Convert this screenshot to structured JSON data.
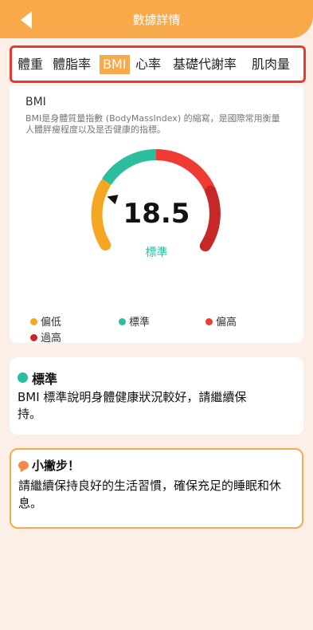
{
  "header": {
    "title": "數據詳情"
  },
  "tabs": [
    {
      "label": "體重",
      "active": false
    },
    {
      "label": "體脂率",
      "active": false
    },
    {
      "label": "BMI",
      "active": true
    },
    {
      "label": "心率",
      "active": false
    },
    {
      "label": "基礎代謝率",
      "active": false
    },
    {
      "label": "肌肉量",
      "active": false
    }
  ],
  "bmi_card": {
    "title": "BMI",
    "description": "BMI是身體質量指數 (BodyMassIndex) 的縮寫，是國際常用衡量人體胖瘦程度以及是否健康的指標。",
    "value": "18.5",
    "status": "標準",
    "legend": [
      {
        "label": "偏低",
        "color": "#f5a623"
      },
      {
        "label": "標準",
        "color": "#2bbd9e"
      },
      {
        "label": "偏高",
        "color": "#ef3b33"
      },
      {
        "label": "過高",
        "color": "#c62828"
      }
    ]
  },
  "status_card": {
    "heading": "標準",
    "text": "BMI 標準說明身體健康狀況較好，請繼續保持。"
  },
  "tip_card": {
    "heading": "小撇步！",
    "text": "請繼續保持良好的生活習慣，確保充足的睡眠和休息。"
  },
  "colors": {
    "accent": "#f8a94a",
    "background": "#fbefe8",
    "highlight_border": "#e53935"
  }
}
